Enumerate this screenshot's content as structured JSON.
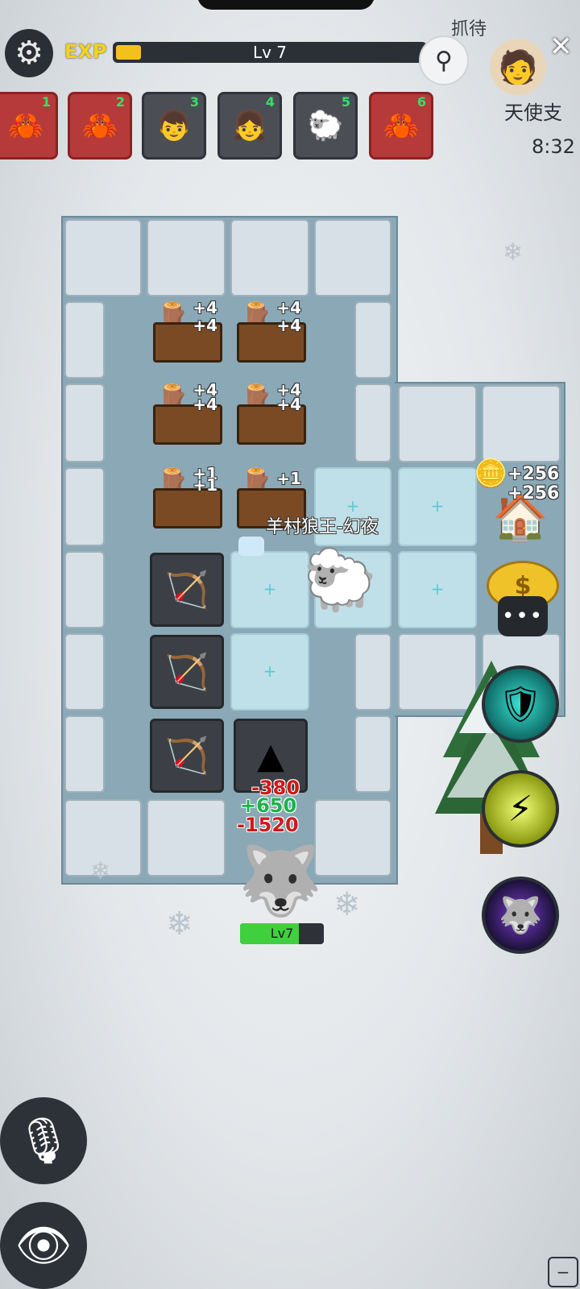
{
  "hud": {
    "exp_label": "EXP",
    "level": "Lv 7",
    "exp_progress": 0.08,
    "top_text": "抓待",
    "angel_text": "天使支",
    "clock": "8:32"
  },
  "cards": [
    {
      "num": "1",
      "icon": "claw-icon",
      "glyph": "🦀",
      "style": "red"
    },
    {
      "num": "2",
      "icon": "claw-icon",
      "glyph": "🦀",
      "style": "red"
    },
    {
      "num": "3",
      "icon": "boy-icon",
      "glyph": "👦",
      "style": "dark"
    },
    {
      "num": "4",
      "icon": "sheep-girl-icon",
      "glyph": "👧",
      "style": "dark"
    },
    {
      "num": "5",
      "icon": "black-sheep-icon",
      "glyph": "🐑",
      "style": "dark"
    },
    {
      "num": "6",
      "icon": "claw-icon",
      "glyph": "🦀",
      "style": "red"
    }
  ],
  "board": {
    "lumber": [
      {
        "bonus_top": "+4",
        "bonus_bottom": "+4"
      },
      {
        "bonus_top": "+4",
        "bonus_bottom": "+4"
      },
      {
        "bonus_top": "+4",
        "bonus_bottom": "+4"
      },
      {
        "bonus_top": "+4",
        "bonus_bottom": "+4"
      },
      {
        "bonus_top": "+1",
        "bonus_bottom": "+1"
      },
      {
        "bonus_top": "",
        "bonus_bottom": "+1"
      }
    ],
    "hero_name": "羊村狼王-幻夜",
    "damage": [
      "-380",
      "+650",
      "-1520"
    ],
    "wolf_level": "Lv7",
    "wolf_hp": 0.7
  },
  "gold": {
    "line1": "+256",
    "line2": "+256",
    "coin_symbol": "$"
  },
  "chat_label": "•••",
  "colors": {
    "accent_exp": "#f2c21c",
    "damage_red": "#d11919",
    "heal_green": "#1cb34a"
  }
}
